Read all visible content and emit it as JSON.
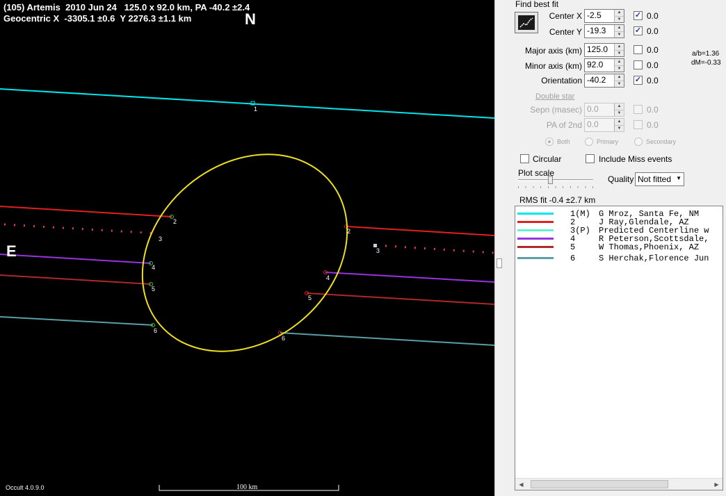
{
  "plot": {
    "title_line1": "(105) Artemis  2010 Jun 24   125.0 x 92.0 km, PA -40.2 ±2.4",
    "title_line2": "Geocentric X  -3305.1 ±0.6  Y 2276.3 ±1.1 km",
    "north_label": "N",
    "east_label": "E",
    "version": "Occult 4.0.9.0",
    "scale_label": "100 km",
    "chord_labels": [
      "1",
      "2",
      "3",
      "4",
      "5",
      "6"
    ],
    "colors": {
      "chord1": "#00e5ee",
      "chord2": "#e02020",
      "chord3": "#e04060",
      "chord4": "#9932e0",
      "chord5": "#b02828",
      "chord6": "#5a9ea6",
      "ellipse": "#f0e020"
    }
  },
  "fit": {
    "section_title": "Find best fit",
    "fit_button_icon": "fit-chart-icon",
    "rows": [
      {
        "label": "Center X",
        "value": "-2.5",
        "checked": true,
        "result": "0.0"
      },
      {
        "label": "Center Y",
        "value": "-19.3",
        "checked": true,
        "result": "0.0"
      },
      {
        "label": "Major axis (km)",
        "value": "125.0",
        "checked": false,
        "result": "0.0"
      },
      {
        "label": "Minor axis (km)",
        "value": "92.0",
        "checked": false,
        "result": "0.0"
      },
      {
        "label": "Orientation",
        "value": "-40.2",
        "checked": true,
        "result": "0.0"
      }
    ],
    "ratio": "a/b=1.36",
    "dm": "dM=-0.33",
    "double_star_link": "Double star",
    "double_rows": [
      {
        "label": "Sepn (masec)",
        "value": "0.0",
        "result": "0.0"
      },
      {
        "label": "PA of 2nd",
        "value": "0.0",
        "result": "0.0"
      }
    ],
    "radio_both": "Both",
    "radio_primary": "Primary",
    "radio_secondary": "Secondary",
    "circular_label": "Circular",
    "include_miss_label": "Include Miss events",
    "plot_scale_label": "Plot scale",
    "plot_scale_fraction": 0.43,
    "quality_label": "Quality",
    "quality_value": "Not fitted",
    "rms": "RMS fit -0.4 ±2.7 km"
  },
  "legend": [
    {
      "num": "1(M)",
      "observer": "G Mroz, Santa Fe, NM",
      "color": "#00e5ee"
    },
    {
      "num": "2",
      "observer": "J Ray,Glendale, AZ",
      "color": "#e02020"
    },
    {
      "num": "3(P)",
      "observer": "Predicted Centerline w",
      "color": "#66f0cc"
    },
    {
      "num": "4",
      "observer": "R Peterson,Scottsdale,",
      "color": "#9932e0"
    },
    {
      "num": "5",
      "observer": "W Thomas,Phoenix, AZ",
      "color": "#b02828"
    },
    {
      "num": "6",
      "observer": "S Herchak,Florence Jun",
      "color": "#5a9ea6"
    }
  ]
}
